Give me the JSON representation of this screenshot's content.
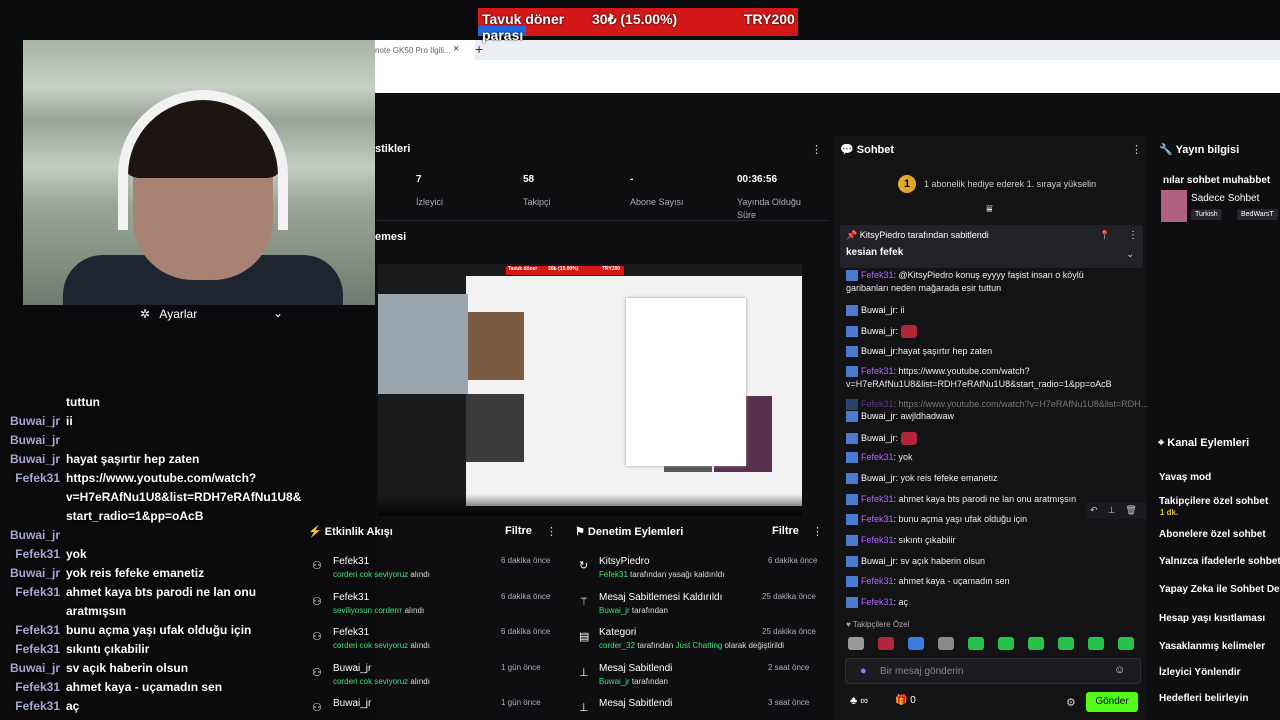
{
  "donation_goal": {
    "title": "Tavuk döner parası",
    "progress_text": "30₺ (15.00%)",
    "target": "TRY200",
    "progress": 0.15
  },
  "browser": {
    "tab_title": "note GK50 Pro Ilgili...",
    "tab_close": "×",
    "new_tab": "+"
  },
  "settings": {
    "label": "Ayarlar"
  },
  "overlay_chat": [
    {
      "user": "",
      "message": "tuttun"
    },
    {
      "user": "Buwai_jr",
      "message": "ii"
    },
    {
      "user": "Buwai_jr",
      "message": ""
    },
    {
      "user": "Buwai_jr",
      "message": "hayat şaşırtır hep zaten"
    },
    {
      "user": "Fefek31",
      "message": "https://www.youtube.com/watch?"
    },
    {
      "user": "",
      "message": "v=H7eRAfNu1U8&list=RDH7eRAfNu1U8&"
    },
    {
      "user": "",
      "message": "start_radio=1&pp=oAcB"
    },
    {
      "user": "Buwai_jr",
      "message": ""
    },
    {
      "user": "Fefek31",
      "message": "yok"
    },
    {
      "user": "Buwai_jr",
      "message": "yok reis fefeke emanetiz"
    },
    {
      "user": "Fefek31",
      "message": "ahmet kaya bts parodi ne lan onu"
    },
    {
      "user": "",
      "message": "aratmışsın"
    },
    {
      "user": "Fefek31",
      "message": "bunu açma yaşı ufak olduğu için"
    },
    {
      "user": "Fefek31",
      "message": "sıkıntı çıkabilir"
    },
    {
      "user": "Buwai_jr",
      "message": "sv açık haberin olsun"
    },
    {
      "user": "Fefek31",
      "message": "ahmet kaya - uçamadın sen"
    },
    {
      "user": "Fefek31",
      "message": "aç"
    }
  ],
  "stats": {
    "title": "stikleri",
    "items": [
      {
        "value": "7",
        "label": "İzleyici"
      },
      {
        "value": "58",
        "label": "Takipçi"
      },
      {
        "value": "-",
        "label": "Abone Sayısı"
      },
      {
        "value": "00:36:56",
        "label": "Yayında Olduğu Süre"
      }
    ]
  },
  "preview": {
    "title": "emesi",
    "goal_title": "Tavuk döner",
    "goal_progress": "30₺ (15.00%)",
    "goal_target": "TRY200"
  },
  "activity": {
    "title": "Etkinlik Akışı",
    "filter": "Filtre",
    "items": [
      {
        "name": "Fefek31",
        "highlight": "corderi cok seviyoruz",
        "suffix": "alındı",
        "time": "6 dakika önce"
      },
      {
        "name": "Fefek31",
        "highlight": "seviliyosun corderrr",
        "suffix": "alındı",
        "time": "6 dakika önce"
      },
      {
        "name": "Fefek31",
        "highlight": "corderi cok seviyoruz",
        "suffix": "alındı",
        "time": "6 dakika önce"
      },
      {
        "name": "Buwai_jr",
        "highlight": "corderi cok seviyoruz",
        "suffix": "alındı",
        "time": "1 gün önce"
      },
      {
        "name": "Buwai_jr",
        "highlight": "",
        "suffix": "",
        "time": "1 gün önce"
      }
    ]
  },
  "moderation": {
    "title": "Denetim Eylemleri",
    "filter": "Filtre",
    "items": [
      {
        "name": "KitsyPiedro",
        "highlight": "Fefek31",
        "suffix": "tarafından yasağı kaldırıldı",
        "extra": "",
        "extra_suffix": "",
        "time": "6 dakika önce"
      },
      {
        "name": "Mesaj Sabitlemesi Kaldırıldı",
        "highlight": "Buwai_jr",
        "suffix": "tarafından",
        "extra": "",
        "extra_suffix": "",
        "time": "25 dakika önce"
      },
      {
        "name": "Kategori",
        "highlight": "corder_32",
        "suffix": "tarafından",
        "extra": "Just Chatting",
        "extra_suffix": "olarak değiştirildi",
        "time": "25 dakika önce"
      },
      {
        "name": "Mesaj Sabitlendi",
        "highlight": "Buwai_jr",
        "suffix": "tarafından",
        "extra": "",
        "extra_suffix": "",
        "time": "2 saat önce"
      },
      {
        "name": "Mesaj Sabitlendi",
        "highlight": "",
        "suffix": "",
        "extra": "",
        "extra_suffix": "",
        "time": "3 saat önce"
      }
    ]
  },
  "chat": {
    "title": "Sohbet",
    "sub_gift": "1 abonelik hediye ederek 1. sıraya yükselin",
    "rank": "1",
    "pinned_by": "KitsyPiedro tarafından sabitlendi",
    "pinned_msg": "kesian fefek",
    "messages": [
      {
        "user": "Fefek31",
        "text": ": @KitsyPiedro konuş eyyyy faşist insan o köylü",
        "cont": "garibanları neden mağarada esir tuttun"
      },
      {
        "user": "Buwai_jr",
        "text": ": ii"
      },
      {
        "user": "Buwai_jr",
        "text": ":"
      },
      {
        "user": "Buwai_jr",
        "text": ":hayat şaşırtır hep zaten"
      },
      {
        "user": "Fefek31",
        "text": ": https://www.youtube.com/watch?",
        "cont": "v=H7eRAfNu1U8&list=RDH7eRAfNu1U8&start_radio=1&pp=oAcB"
      },
      {
        "user": "Fefek31",
        "text": ": https://www.youtube.com/watch?v=H7eRAfNu1U8&list=RDH..."
      },
      {
        "user": "Buwai_jr",
        "text": ": awjldhadwaw"
      },
      {
        "user": "Buwai_jr",
        "text": ":"
      },
      {
        "user": "Fefek31",
        "text": ": yok"
      },
      {
        "user": "Buwai_jr",
        "text": ": yok reis fefeke emanetiz"
      },
      {
        "user": "Fefek31",
        "text": ": ahmet kaya bts parodi ne lan onu aratmışsın"
      },
      {
        "user": "Fefek31",
        "text": ": bunu açma yaşı ufak olduğu için"
      },
      {
        "user": "Fefek31",
        "text": ": sıkıntı çıkabilir"
      },
      {
        "user": "Buwai_jr",
        "text": ": sv açık haberin olsun"
      },
      {
        "user": "Fefek31",
        "text": ": ahmet kaya - uçamadın sen"
      },
      {
        "user": "Fefek31",
        "text": ": aç"
      }
    ],
    "followers_only": "Takipçilere Özel",
    "input_placeholder": "Bir mesaj gönderin",
    "points": "∞",
    "gifts": "0",
    "send": "Gönder"
  },
  "stream_info": {
    "title": "Yayın bilgisi",
    "stream_title": "nılar sohbet muhabbet",
    "category": "Sadece Sohbet",
    "tags": [
      "Turkish",
      "BedWarsT"
    ]
  },
  "channel_actions": {
    "title": "Kanal Eylemleri",
    "items": [
      "Yavaş mod",
      "Takipçilere özel sohbet",
      "Abonelere özel sohbet",
      "Yalnızca ifadelerle sohbet",
      "Yapay Zeka ile Sohbet Den",
      "Hesap yaşı kısıtlaması",
      "Yasaklanmış kelimeler",
      "İzleyici Yönlendir",
      "Hedefleri belirleyin"
    ],
    "follower_sub": "1 dk."
  }
}
